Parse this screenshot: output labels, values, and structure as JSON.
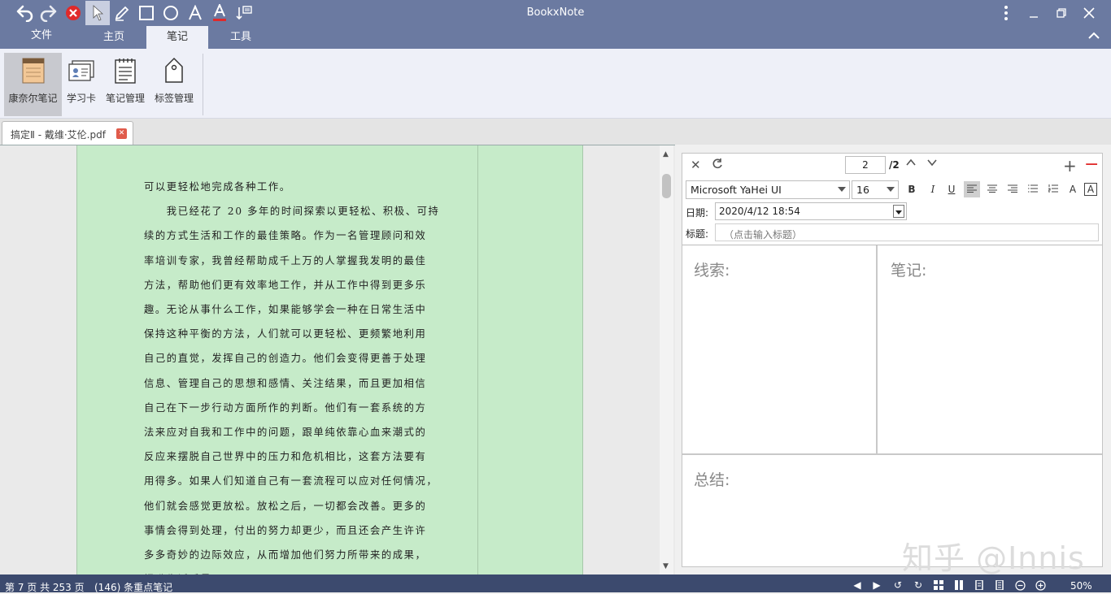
{
  "app": {
    "title": "BookxNote"
  },
  "ribbon_tabs": [
    {
      "label": "文件"
    },
    {
      "label": "主页"
    },
    {
      "label": "笔记"
    },
    {
      "label": "工具"
    }
  ],
  "ribbon": {
    "buttons": [
      {
        "label": "康奈尔笔记",
        "icon": "cornell-notepad-icon",
        "active": true
      },
      {
        "label": "学习卡",
        "icon": "study-card-icon"
      },
      {
        "label": "笔记管理",
        "icon": "note-management-icon"
      },
      {
        "label": "标签管理",
        "icon": "tag-management-icon"
      }
    ]
  },
  "doc_tab": {
    "label": "搞定Ⅱ - 戴维·艾伦.pdf"
  },
  "pdf_page": {
    "lines": [
      "可以更轻松地完成各种工作。",
      "　　我已经花了 20 多年的时间探索以更轻松、积极、可持",
      "续的方式生活和工作的最佳策略。作为一名管理顾问和效",
      "率培训专家，我曾经帮助成千上万的人掌握我发明的最佳",
      "方法，帮助他们更有效率地工作，并从工作中得到更多乐",
      "趣。无论从事什么工作，如果能够学会一种在日常生活中",
      "保持这种平衡的方法，人们就可以更轻松、更频繁地利用",
      "自己的直觉，发挥自己的创造力。他们会变得更善于处理",
      "信息、管理自己的思想和感情、关注结果，而且更加相信",
      "自己在下一步行动方面所作的判断。他们有一套系统的方",
      "法来应对自我和工作中的问题，跟单纯依靠心血来潮式的",
      "反应来摆脱自己世界中的压力和危机相比，这套方法要有",
      "用得多。如果人们知道自己有一套流程可以应对任何情况，",
      "他们就会感觉更放松。放松之后，一切都会改善。更多的",
      "事情会得到处理，付出的努力却更少，而且还会产生许许",
      "多多奇妙的边际效应，从而增加他们努力所带来的成果，",
      "提升生活质量。"
    ]
  },
  "note_panel": {
    "page_current": "2",
    "page_total": "/2",
    "font_family": "Microsoft YaHei UI",
    "font_size": "16",
    "date_label": "日期:",
    "date_value": "2020/4/12 18:54",
    "title_label": "标题:",
    "title_placeholder": "（点击输入标题）",
    "cue_label": "线索:",
    "notes_label": "笔记:",
    "summary_label": "总结:",
    "watermark": "知乎 @Innis"
  },
  "status": {
    "page_info": "第 7 页 共 253 页",
    "notes_count": "(146) 条重点笔记",
    "zoom": "50%"
  }
}
